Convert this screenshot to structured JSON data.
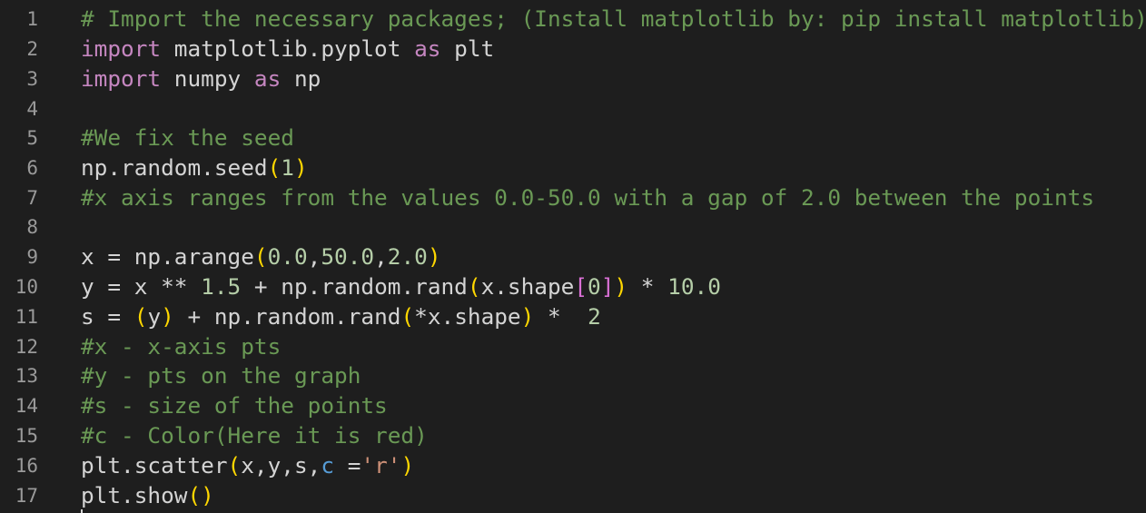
{
  "colors": {
    "background": "#1e1e1e",
    "line_number": "#9a9a9a",
    "comment": "#6a9955",
    "keyword": "#c586c0",
    "identifier": "#d4d4d4",
    "number": "#b5cea8",
    "string": "#ce9178",
    "paren": "#ffd700",
    "bracket": "#da70d6",
    "param": "#569cd6"
  },
  "lines": [
    {
      "number": "1",
      "tokens": [
        {
          "t": "# Import the necessary packages; (Install matplotlib by: pip install matplotlib)",
          "c": "cmt"
        }
      ]
    },
    {
      "number": "2",
      "tokens": [
        {
          "t": "import",
          "c": "kw"
        },
        {
          "t": " matplotlib.pyplot ",
          "c": "id"
        },
        {
          "t": "as",
          "c": "kw"
        },
        {
          "t": " plt",
          "c": "id"
        }
      ]
    },
    {
      "number": "3",
      "tokens": [
        {
          "t": "import",
          "c": "kw"
        },
        {
          "t": " numpy ",
          "c": "id"
        },
        {
          "t": "as",
          "c": "kw"
        },
        {
          "t": " np",
          "c": "id"
        }
      ]
    },
    {
      "number": "4",
      "tokens": []
    },
    {
      "number": "5",
      "tokens": [
        {
          "t": "#We fix the seed",
          "c": "cmt"
        }
      ]
    },
    {
      "number": "6",
      "tokens": [
        {
          "t": "np.random.seed",
          "c": "id"
        },
        {
          "t": "(",
          "c": "paren"
        },
        {
          "t": "1",
          "c": "num"
        },
        {
          "t": ")",
          "c": "paren"
        }
      ]
    },
    {
      "number": "7",
      "tokens": [
        {
          "t": "#x axis ranges from the values 0.0-50.0 with a gap of 2.0 between the points",
          "c": "cmt"
        }
      ]
    },
    {
      "number": "8",
      "tokens": []
    },
    {
      "number": "9",
      "tokens": [
        {
          "t": "x = np.arange",
          "c": "id"
        },
        {
          "t": "(",
          "c": "paren"
        },
        {
          "t": "0.0",
          "c": "num"
        },
        {
          "t": ",",
          "c": "id"
        },
        {
          "t": "50.0",
          "c": "num"
        },
        {
          "t": ",",
          "c": "id"
        },
        {
          "t": "2.0",
          "c": "num"
        },
        {
          "t": ")",
          "c": "paren"
        }
      ]
    },
    {
      "number": "10",
      "tokens": [
        {
          "t": "y = x ** ",
          "c": "id"
        },
        {
          "t": "1.5",
          "c": "num"
        },
        {
          "t": " + np.random.rand",
          "c": "id"
        },
        {
          "t": "(",
          "c": "paren"
        },
        {
          "t": "x.shape",
          "c": "id"
        },
        {
          "t": "[",
          "c": "brk"
        },
        {
          "t": "0",
          "c": "num"
        },
        {
          "t": "]",
          "c": "brk"
        },
        {
          "t": ")",
          "c": "paren"
        },
        {
          "t": " * ",
          "c": "id"
        },
        {
          "t": "10.0",
          "c": "num"
        }
      ]
    },
    {
      "number": "11",
      "tokens": [
        {
          "t": "s = ",
          "c": "id"
        },
        {
          "t": "(",
          "c": "paren"
        },
        {
          "t": "y",
          "c": "id"
        },
        {
          "t": ")",
          "c": "paren"
        },
        {
          "t": " + np.random.rand",
          "c": "id"
        },
        {
          "t": "(",
          "c": "paren"
        },
        {
          "t": "*x.shape",
          "c": "id"
        },
        {
          "t": ")",
          "c": "paren"
        },
        {
          "t": " *  ",
          "c": "id"
        },
        {
          "t": "2",
          "c": "num"
        }
      ]
    },
    {
      "number": "12",
      "tokens": [
        {
          "t": "#x - x-axis pts",
          "c": "cmt"
        }
      ]
    },
    {
      "number": "13",
      "tokens": [
        {
          "t": "#y - pts on the graph",
          "c": "cmt"
        }
      ]
    },
    {
      "number": "14",
      "tokens": [
        {
          "t": "#s - size of the points",
          "c": "cmt"
        }
      ]
    },
    {
      "number": "15",
      "tokens": [
        {
          "t": "#c - Color(Here it is red)",
          "c": "cmt"
        }
      ]
    },
    {
      "number": "16",
      "tokens": [
        {
          "t": "plt.scatter",
          "c": "id"
        },
        {
          "t": "(",
          "c": "paren"
        },
        {
          "t": "x,y,s,",
          "c": "id"
        },
        {
          "t": "c",
          "c": "blue"
        },
        {
          "t": " =",
          "c": "id"
        },
        {
          "t": "'r'",
          "c": "str"
        },
        {
          "t": ")",
          "c": "paren"
        }
      ]
    },
    {
      "number": "17",
      "tokens": [
        {
          "t": "plt.show",
          "c": "id"
        },
        {
          "t": "()",
          "c": "paren"
        }
      ]
    }
  ]
}
